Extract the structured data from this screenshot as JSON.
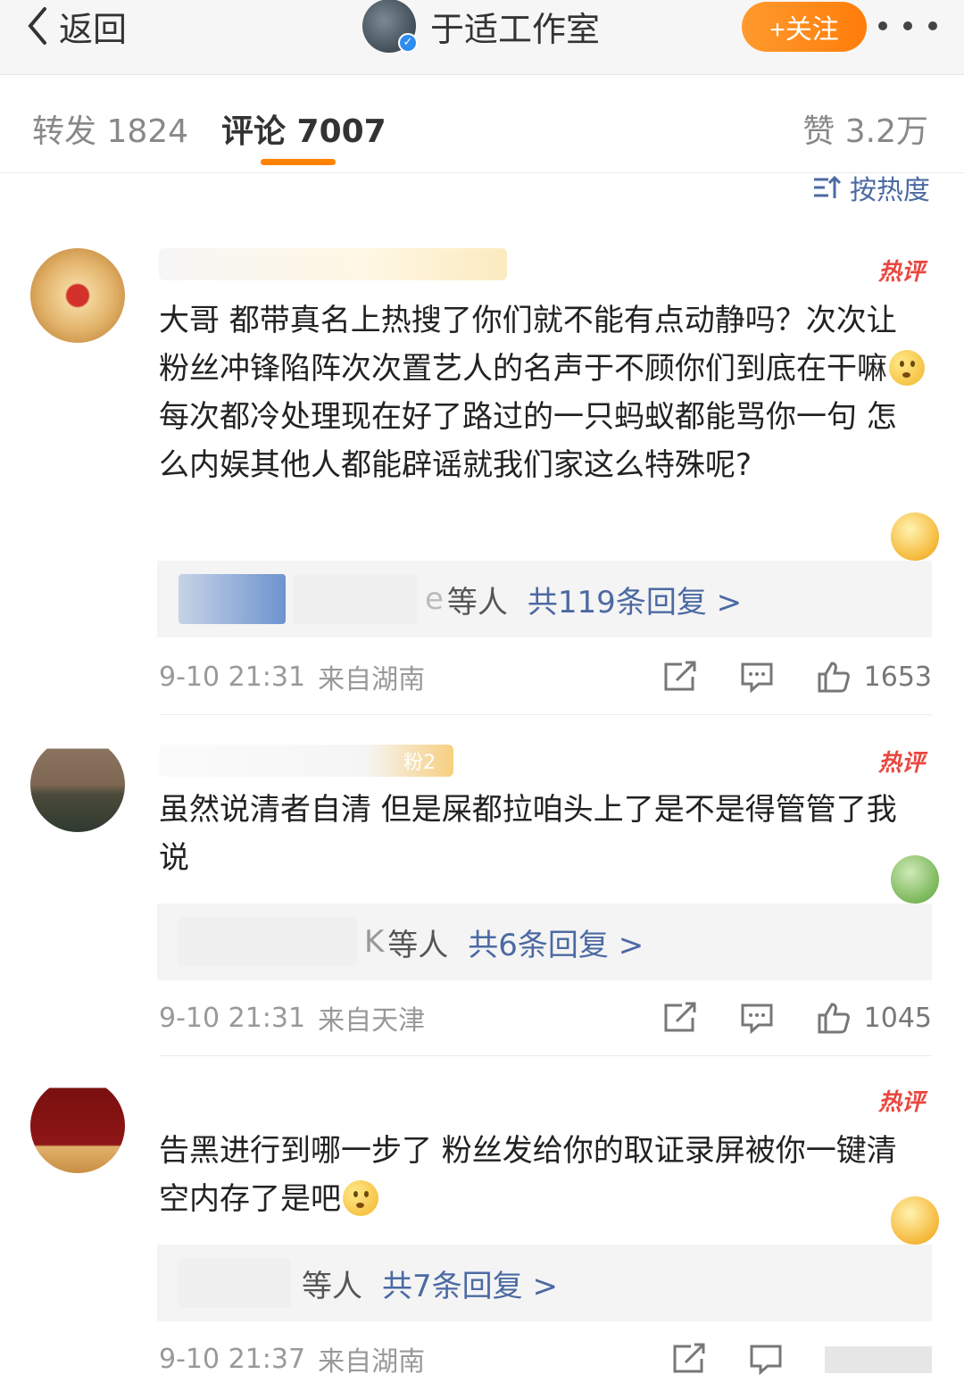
{
  "header": {
    "back_label": "返回",
    "account_name": "于适工作室",
    "follow_label": "+关注"
  },
  "tabs": {
    "repost": "转发 1824",
    "comments": "评论 7007",
    "likes": "赞 3.2万"
  },
  "sort_label": "按热度",
  "comments": [
    {
      "badge": "热评",
      "text_a": "大哥 都带真名上热搜了你们就不能有点动静吗？次次让粉丝冲锋陷阵次次置艺人的名声于不顾你们到底在干嘛",
      "text_b": "每次都冷处理现在好了路过的一只蚂蚁都能骂你一句 怎么内娱其他人都能辟谣就我们家这么特殊呢?",
      "reply_suffix": "e",
      "reply_who": "等人",
      "reply_link": "共119条回复 >",
      "time": "9-10 21:31",
      "location": "来自湖南",
      "likes": "1653"
    },
    {
      "badge": "热评",
      "fan_badge": "粉2",
      "text_a": "虽然说清者自清 但是屎都拉咱头上了是不是得管管了我说",
      "reply_suffix": "K",
      "reply_who": "等人",
      "reply_link": "共6条回复 >",
      "time": "9-10 21:31",
      "location": "来自天津",
      "likes": "1045"
    },
    {
      "badge": "热评",
      "text_a": "告黑进行到哪一步了 粉丝发给你的取证录屏被你一键清空内存了是吧",
      "reply_who": "等人",
      "reply_link": "共7条回复 >",
      "time": "9-10 21:37",
      "location": "来自湖南"
    }
  ],
  "colors": {
    "accent_orange": "#ff8200",
    "link_blue": "#4b6aa3",
    "hot_red": "#e8473f"
  }
}
